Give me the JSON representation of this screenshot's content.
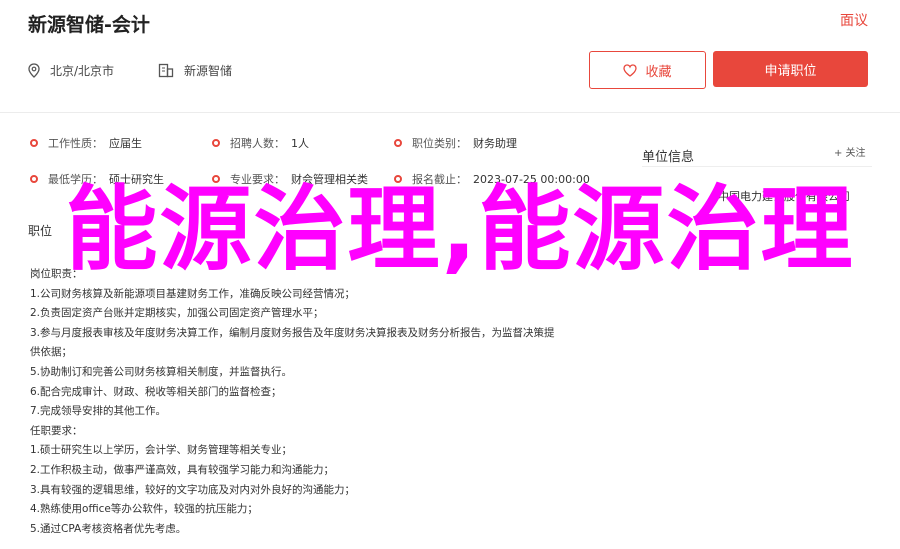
{
  "header": {
    "title": "新源智储-会计",
    "location": "北京/北京市",
    "company": "新源智储",
    "report": "面议",
    "favorite_label": "收藏",
    "apply_label": "申请职位"
  },
  "attributes": [
    [
      {
        "label": "工作性质：",
        "value": "应届生"
      },
      {
        "label": "招聘人数：",
        "value": "1人"
      },
      {
        "label": "职位类别：",
        "value": "财务助理"
      }
    ],
    [
      {
        "label": "最低学历：",
        "value": "硕士研究生"
      },
      {
        "label": "专业要求：",
        "value": "财会管理相关类"
      },
      {
        "label": "报名截止：",
        "value": "2023-07-25 00:00:00"
      }
    ]
  ],
  "section": {
    "heading": "职位"
  },
  "description": [
    "岗位职责：",
    "1.公司财务核算及新能源项目基建财务工作，准确反映公司经营情况；",
    "2.负责固定资产台账并定期核实，加强公司固定资产管理水平；",
    "3.参与月度报表审核及年度财务决算工作，编制月度财务报告及年度财务决算报表及财务分析报告，为监督决策提",
    "供依据；",
    "5.协助制订和完善公司财务核算相关制度，并监督执行。",
    "6.配合完成审计、财政、税收等相关部门的监督检查；",
    "7.完成领导安排的其他工作。",
    "任职要求：",
    "1.硕士研究生以上学历，会计学、财务管理等相关专业；",
    "2.工作积极主动，做事严谨高效，具有较强学习能力和沟通能力；",
    "3.具有较强的逻辑思维，较好的文字功底及对内对外良好的沟通能力；",
    "4.熟练使用office等办公软件，较强的抗压能力；",
    "5.通过CPA考核资格者优先考虑。"
  ],
  "sidebar": {
    "title": "单位信息",
    "follow_label": "+ 关注",
    "company_name": "中国电力建设股份有限公司"
  },
  "watermark": {
    "text": "能源治理,能源治理"
  },
  "colors": {
    "accent": "#e8473c",
    "watermark": "#ff00ff"
  }
}
